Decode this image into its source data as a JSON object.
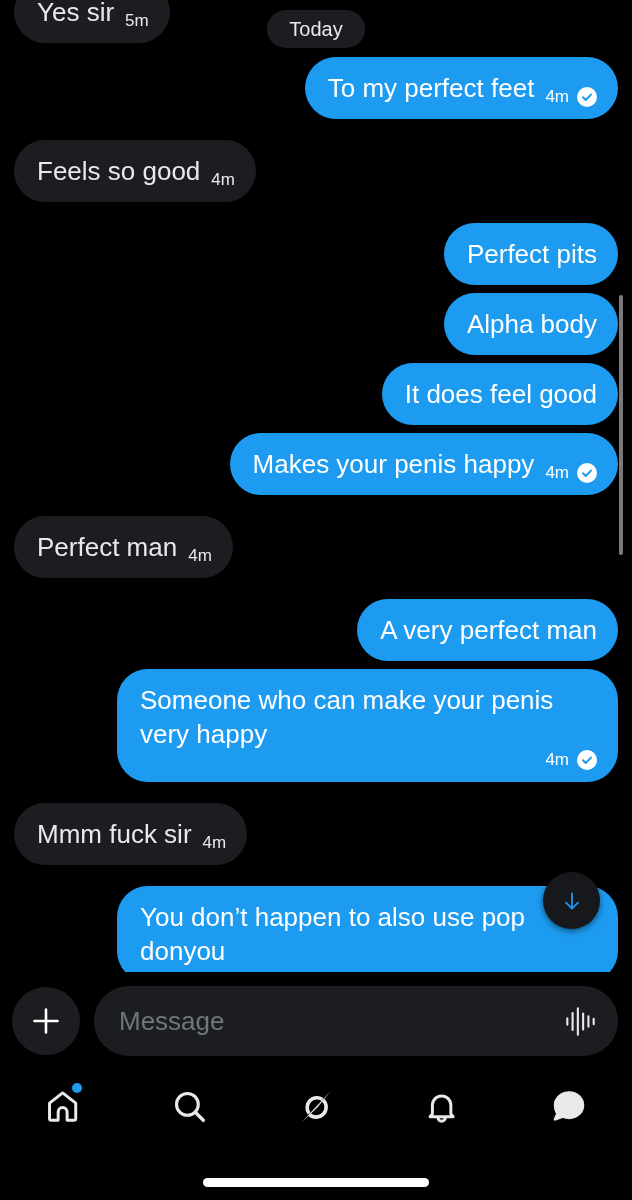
{
  "thread": [
    {
      "kind": "received",
      "text": "Yes sir",
      "time": "5m",
      "receipt": false
    },
    {
      "kind": "date",
      "label": "Today"
    },
    {
      "kind": "sent",
      "text": "To my perfect feet",
      "time": "4m",
      "receipt": true
    },
    {
      "kind": "received",
      "text": "Feels so good",
      "time": "4m",
      "receipt": false
    },
    {
      "kind": "sent",
      "text": "Perfect pits",
      "receipt": false
    },
    {
      "kind": "sent",
      "text": "Alpha body",
      "receipt": false
    },
    {
      "kind": "sent",
      "text": "It does feel good",
      "receipt": false
    },
    {
      "kind": "sent",
      "text": "Makes your penis happy",
      "time": "4m",
      "receipt": true
    },
    {
      "kind": "received",
      "text": "Perfect man",
      "time": "4m",
      "receipt": false
    },
    {
      "kind": "sent",
      "text": "A very perfect man",
      "receipt": false
    },
    {
      "kind": "sent",
      "text": "Someone who can make your penis very happy",
      "time": "4m",
      "receipt": true
    },
    {
      "kind": "received",
      "text": "Mmm fuck sir",
      "time": "4m",
      "receipt": false
    },
    {
      "kind": "sent",
      "text": "You don’t happen to also use pop donyou",
      "receipt": false
    }
  ],
  "composer": {
    "placeholder": "Message"
  },
  "nav": [
    {
      "kind": "home",
      "selected": false,
      "dot": true
    },
    {
      "kind": "search",
      "selected": false,
      "dot": false
    },
    {
      "kind": "assistant",
      "selected": false,
      "dot": false
    },
    {
      "kind": "notifications",
      "selected": false,
      "dot": false
    },
    {
      "kind": "messages",
      "selected": true,
      "dot": false
    }
  ]
}
